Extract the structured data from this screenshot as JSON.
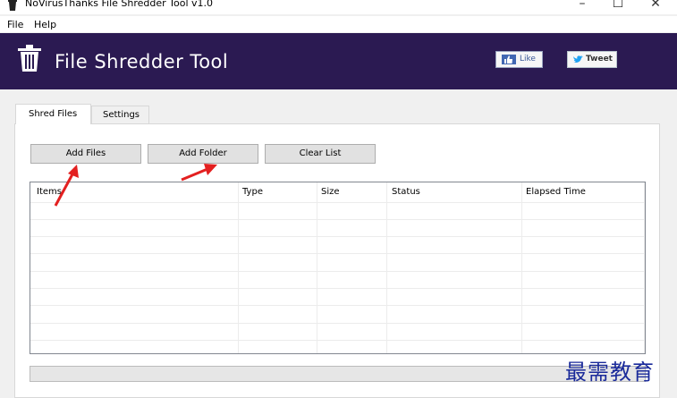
{
  "window": {
    "title": "NoVirusThanks File Shredder Tool v1.0",
    "minimize": "–",
    "maximize": "☐",
    "close": "✕"
  },
  "menu": {
    "file": "File",
    "help": "Help"
  },
  "header": {
    "title": "File Shredder Tool",
    "like_label": "Like",
    "tweet_label": "Tweet"
  },
  "tabs": [
    {
      "label": "Shred Files",
      "active": true
    },
    {
      "label": "Settings",
      "active": false
    }
  ],
  "toolbar": {
    "add_files": "Add Files",
    "add_folder": "Add Folder",
    "clear_list": "Clear List"
  },
  "list": {
    "columns": [
      "Items",
      "Type",
      "Size",
      "Status",
      "Elapsed Time"
    ],
    "rows": []
  },
  "progress": {
    "value": 0
  },
  "watermark": "最需教育",
  "colors": {
    "header_bg": "#2b1a52",
    "annotation_arrow": "#e32020"
  },
  "icons": [
    "trash-icon",
    "like-thumb-icon",
    "twitter-bird-icon"
  ]
}
